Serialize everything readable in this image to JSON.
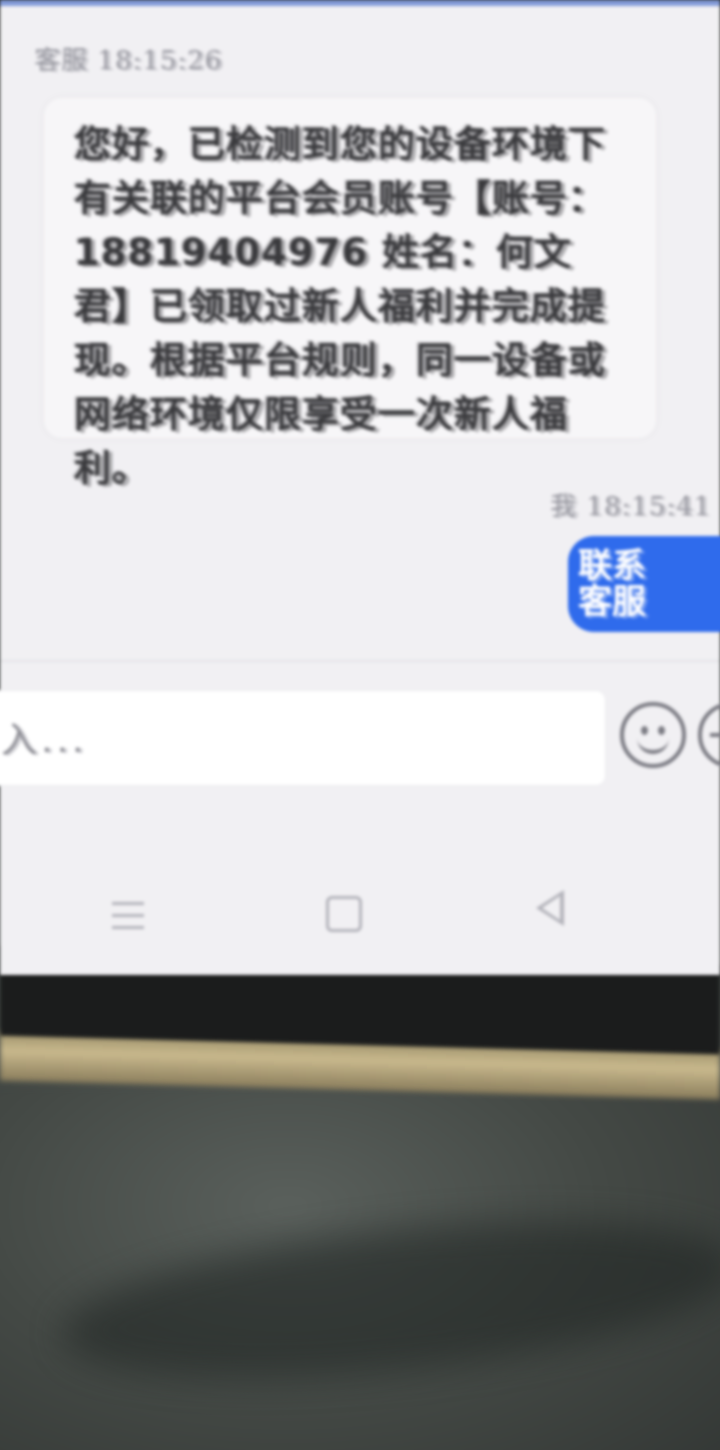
{
  "chat": {
    "agent_message": {
      "sender": "客服",
      "time": "18:15:26",
      "text": "您好，已检测到您的设备环境下有关联的平台会员账号【账号：18819404976 姓名：何文君】已领取过新人福利并完成提现。根据平台规则，同一设备或网络环境仅限享受一次新人福利。"
    },
    "user_message": {
      "sender": "我",
      "time": "18:15:41",
      "text": "联系客服"
    }
  },
  "composer": {
    "placeholder": "入..."
  },
  "icons": {
    "emoji": "smiley-face-icon",
    "more": "plus-circle-icon",
    "nav_menu": "menu-lines-icon",
    "nav_home": "square-home-icon",
    "nav_back": "triangle-back-icon"
  },
  "colors": {
    "screen_bg": "#f1f0f3",
    "user_bubble": "#2f6bec",
    "agent_bubble": "#f7f6f8",
    "meta_text": "#9a9aa2"
  }
}
